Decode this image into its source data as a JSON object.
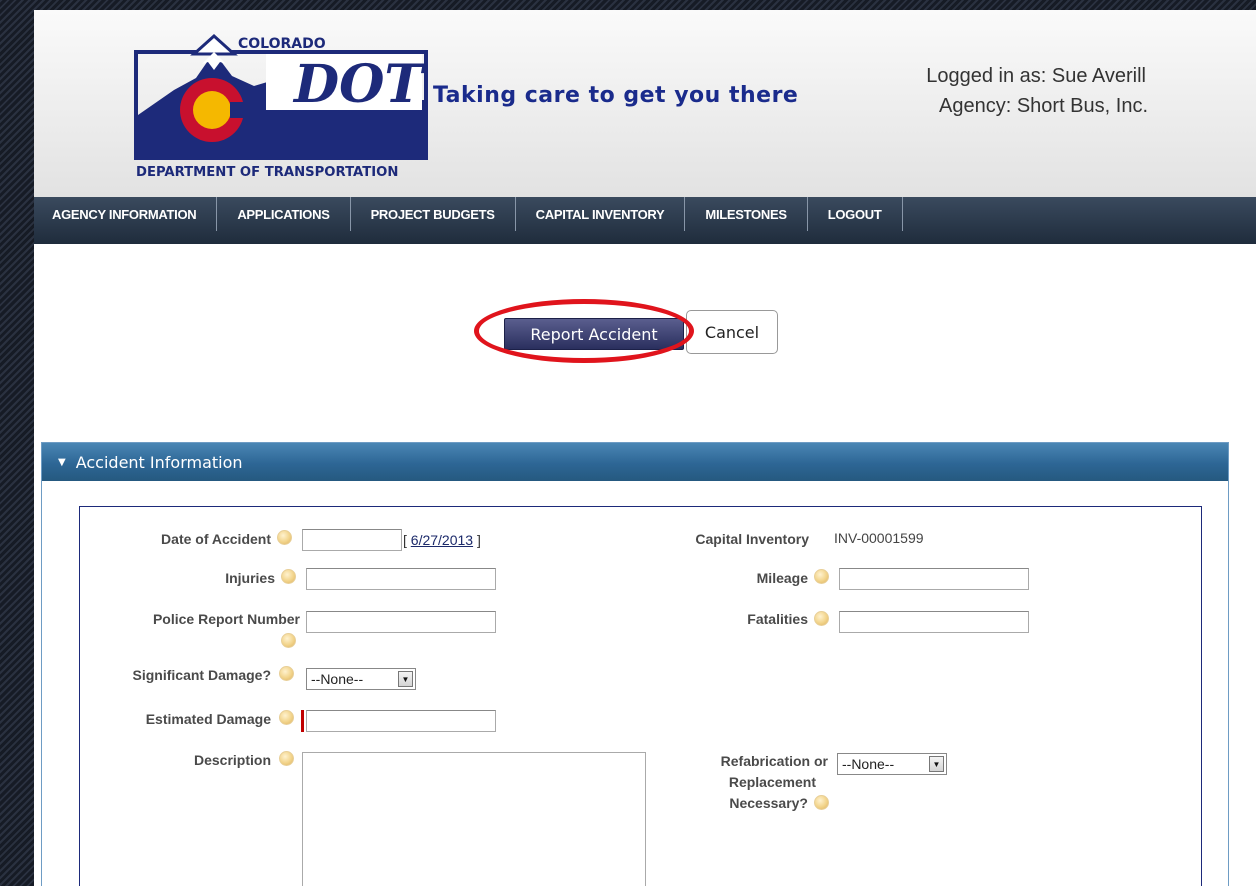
{
  "header": {
    "logo": {
      "top_text": "COLORADO",
      "main_text": "DOT",
      "bottom_text": "DEPARTMENT OF TRANSPORTATION"
    },
    "tagline": "Taking care to get you there",
    "logged_in": "Logged in as: Sue Averill",
    "agency": "Agency: Short Bus, Inc."
  },
  "nav": {
    "items": [
      {
        "label": "AGENCY INFORMATION"
      },
      {
        "label": "APPLICATIONS"
      },
      {
        "label": "PROJECT BUDGETS"
      },
      {
        "label": "CAPITAL INVENTORY"
      },
      {
        "label": "MILESTONES"
      },
      {
        "label": "LOGOUT"
      }
    ]
  },
  "actions": {
    "report_label": "Report Accident",
    "cancel_label": "Cancel"
  },
  "section": {
    "title": "Accident Information",
    "icon": "triangle-down-icon"
  },
  "form": {
    "date_label": "Date of Accident",
    "date_today": "6/27/2013",
    "date_open": "[ ",
    "date_close": " ]",
    "injuries_label": "Injuries",
    "police_label": "Police Report Number",
    "significant_label": "Significant Damage?",
    "significant_value": "--None--",
    "estimated_label": "Estimated Damage",
    "description_label": "Description",
    "capital_label": "Capital Inventory",
    "capital_value": "INV-00001599",
    "mileage_label": "Mileage",
    "fatalities_label": "Fatalities",
    "refab_label_1": "Refabrication or",
    "refab_label_2": "Replacement",
    "refab_label_3": "Necessary?",
    "refab_value": "--None--"
  },
  "colors": {
    "nav_bg": "#1f2c3c",
    "section_header": "#2d6695",
    "highlight": "#e0141c",
    "dot_blue": "#1d2a7a",
    "required": "#c00000"
  }
}
